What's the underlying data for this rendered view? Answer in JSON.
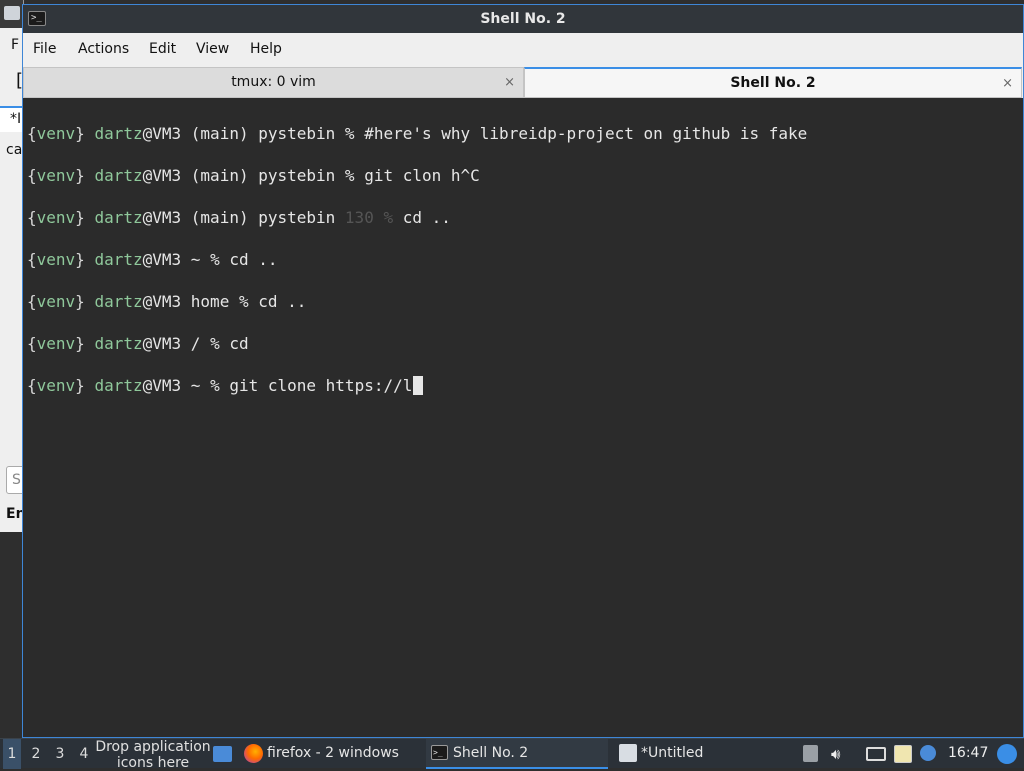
{
  "window": {
    "title": "Shell No. 2"
  },
  "menu": [
    "File",
    "Actions",
    "Edit",
    "View",
    "Help"
  ],
  "tabs": [
    {
      "label": "tmux: 0 vim",
      "close": "×"
    },
    {
      "label": "Shell No. 2",
      "close": "×"
    }
  ],
  "terminal": {
    "lines": [
      {
        "open": "{",
        "venv": "venv",
        "close": "}",
        "user": "dartz",
        "host": "@VM3",
        "cwd": " (main) pystebin ",
        "status": "",
        "prompt": "%",
        "cmd": " #here's why libreidp-project on github is fake"
      },
      {
        "open": "{",
        "venv": "venv",
        "close": "}",
        "user": "dartz",
        "host": "@VM3",
        "cwd": " (main) pystebin ",
        "status": "",
        "prompt": "%",
        "cmd": " git clon h^C"
      },
      {
        "open": "{",
        "venv": "venv",
        "close": "}",
        "user": "dartz",
        "host": "@VM3",
        "cwd": " (main) pystebin ",
        "status": "130 ",
        "prompt": "%",
        "cmd": " cd .."
      },
      {
        "open": "{",
        "venv": "venv",
        "close": "}",
        "user": "dartz",
        "host": "@VM3",
        "cwd": " ~ ",
        "status": "",
        "prompt": "%",
        "cmd": " cd .."
      },
      {
        "open": "{",
        "venv": "venv",
        "close": "}",
        "user": "dartz",
        "host": "@VM3",
        "cwd": " home ",
        "status": "",
        "prompt": "%",
        "cmd": " cd .."
      },
      {
        "open": "{",
        "venv": "venv",
        "close": "}",
        "user": "dartz",
        "host": "@VM3",
        "cwd": " / ",
        "status": "",
        "prompt": "%",
        "cmd": " cd"
      },
      {
        "open": "{",
        "venv": "venv",
        "close": "}",
        "user": "dartz",
        "host": "@VM3",
        "cwd": " ~ ",
        "status": "",
        "prompt": "%",
        "cmd": " git clone https://l"
      }
    ]
  },
  "background_window": {
    "menu_fragment": "F",
    "tab_fragment": "*I",
    "text_fragment": "ca",
    "input_fragment": "S",
    "bold_fragment": "En"
  },
  "taskbar": {
    "workspaces": [
      "1",
      "2",
      "3",
      "4"
    ],
    "drop_hint_line1": "Drop application",
    "drop_hint_line2": "icons here",
    "tasks": [
      {
        "label": "firefox - 2 windows"
      },
      {
        "label": "Shell No. 2"
      },
      {
        "label": "*Untitled"
      }
    ],
    "clock": "16:47"
  },
  "colors": {
    "accent": "#3a8ee6",
    "terminal_bg": "#2b2b2b",
    "prompt_green": "#8fc89b",
    "taskbar_bg": "#2b3138"
  }
}
